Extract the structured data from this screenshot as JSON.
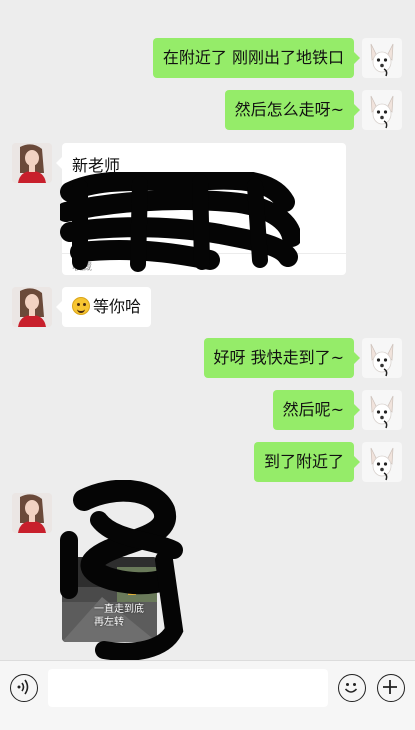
{
  "messages": [
    {
      "side": "me",
      "text": "在附近了 刚刚出了地铁口"
    },
    {
      "side": "me",
      "text": "然后怎么走呀~"
    },
    {
      "side": "other",
      "type": "card",
      "title": "新老师",
      "footer": "收藏"
    },
    {
      "side": "other",
      "text": "等你哈",
      "emoji": "smile-emoji"
    },
    {
      "side": "me",
      "text": "好呀 我快走到了~"
    },
    {
      "side": "me",
      "text": "然后呢~"
    },
    {
      "side": "me",
      "text": "到了附近了"
    },
    {
      "side": "other",
      "type": "image",
      "caption_line1": "一直走到底",
      "caption_line2": "再左转"
    }
  ],
  "input_bar": {
    "voice_icon": "voice-icon",
    "emoji_icon": "emoji-icon",
    "plus_icon": "plus-icon",
    "text_value": ""
  },
  "colors": {
    "my_bubble": "#95ec69",
    "other_bubble": "#ffffff",
    "chat_background": "#ededed"
  }
}
